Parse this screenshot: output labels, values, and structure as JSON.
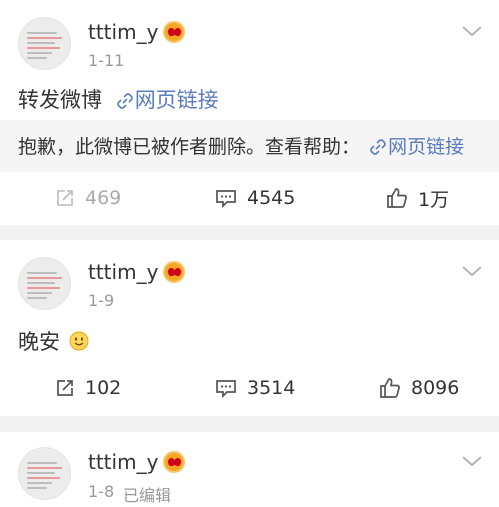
{
  "posts": [
    {
      "username": "tttim_y",
      "date": "1-11",
      "content_text": "转发微博",
      "content_link": "网页链接",
      "deleted_notice": "抱歉，此微博已被作者删除。查看帮助：",
      "deleted_link": "网页链接",
      "stats": {
        "reposts": "469",
        "comments": "4545",
        "likes": "1万"
      }
    },
    {
      "username": "tttim_y",
      "date": "1-9",
      "content_text": "晚安",
      "content_emoji": "smile-emoji",
      "stats": {
        "reposts": "102",
        "comments": "3514",
        "likes": "8096"
      }
    },
    {
      "username": "tttim_y",
      "date": "1-8",
      "edited": "已编辑"
    }
  ],
  "colors": {
    "link": "#5b7cbf",
    "background": "#f2f2f2",
    "card": "#ffffff",
    "muted": "#999999"
  },
  "icons": {
    "repost": "repost-icon",
    "comment": "comment-icon",
    "like": "thumbs-up-icon",
    "menu": "chevron-down-icon",
    "verified": "heart-eyes-badge-icon"
  }
}
